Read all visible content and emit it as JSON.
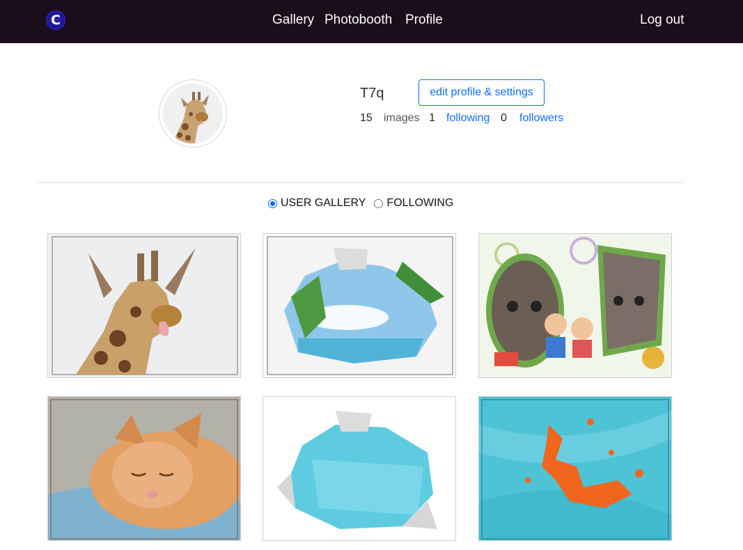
{
  "navbar": {
    "logo_letter": "C",
    "links": {
      "gallery": "Gallery",
      "photobooth": "Photobooth",
      "profile": "Profile"
    },
    "logout": "Log out"
  },
  "profile": {
    "username": "T7q",
    "edit_button": "edit profile & settings",
    "images_count": "15",
    "images_label": "images",
    "following_count": "1",
    "following_label": "following",
    "followers_count": "0",
    "followers_label": "followers",
    "avatar_icon": "giraffe-avatar"
  },
  "view_toggle": {
    "options": [
      {
        "label": "USER GALLERY",
        "checked": true
      },
      {
        "label": "FOLLOWING",
        "checked": false
      }
    ]
  },
  "gallery": {
    "images": [
      {
        "subject": "giraffe-photo"
      },
      {
        "subject": "torn-paper-beach-photo"
      },
      {
        "subject": "kittens-baby-frame-photo"
      },
      {
        "subject": "sleeping-kitten-photo"
      },
      {
        "subject": "torn-paper-blue-photo"
      },
      {
        "subject": "orange-paint-splash-photo"
      }
    ]
  },
  "colors": {
    "navbar_bg": "#1c0d1b",
    "link_blue": "#0d6efd",
    "logo_blue": "#1a1290"
  }
}
